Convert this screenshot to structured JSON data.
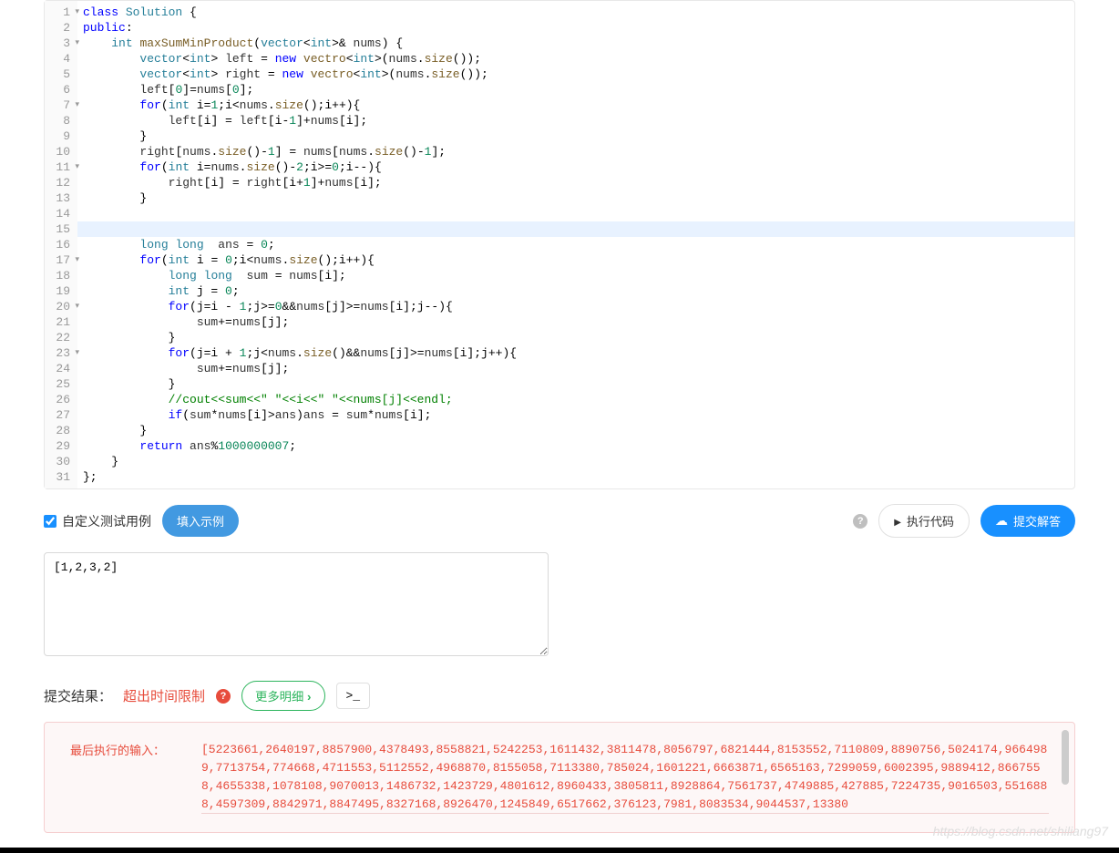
{
  "gutter": {
    "lines": [
      "1",
      "2",
      "3",
      "4",
      "5",
      "6",
      "7",
      "8",
      "9",
      "10",
      "11",
      "12",
      "13",
      "14",
      "15",
      "16",
      "17",
      "18",
      "19",
      "20",
      "21",
      "22",
      "23",
      "24",
      "25",
      "26",
      "27",
      "28",
      "29",
      "30",
      "31"
    ],
    "folds": [
      0,
      2,
      6,
      10,
      16,
      19,
      22
    ]
  },
  "code": [
    [
      [
        "kw",
        "class "
      ],
      [
        "cls",
        "Solution"
      ],
      [
        "op",
        " {"
      ]
    ],
    [
      [
        "kw",
        "public"
      ],
      [
        "op",
        ":"
      ]
    ],
    [
      [
        "op",
        "    "
      ],
      [
        "type",
        "int"
      ],
      [
        "op",
        " "
      ],
      [
        "func",
        "maxSumMinProduct"
      ],
      [
        "op",
        "("
      ],
      [
        "type",
        "vector"
      ],
      [
        "op",
        "<"
      ],
      [
        "type",
        "int"
      ],
      [
        "op",
        ">& "
      ],
      [
        "",
        "nums"
      ],
      [
        "op",
        ") {"
      ]
    ],
    [
      [
        "op",
        "        "
      ],
      [
        "type",
        "vector"
      ],
      [
        "op",
        "<"
      ],
      [
        "type",
        "int"
      ],
      [
        "op",
        "> "
      ],
      [
        "",
        "left"
      ],
      [
        "op",
        " = "
      ],
      [
        "kw",
        "new"
      ],
      [
        "op",
        " "
      ],
      [
        "func",
        "vectro"
      ],
      [
        "op",
        "<"
      ],
      [
        "type",
        "int"
      ],
      [
        "op",
        ">("
      ],
      [
        "",
        "nums"
      ],
      [
        "op",
        "."
      ],
      [
        "func",
        "size"
      ],
      [
        "op",
        "());"
      ]
    ],
    [
      [
        "op",
        "        "
      ],
      [
        "type",
        "vector"
      ],
      [
        "op",
        "<"
      ],
      [
        "type",
        "int"
      ],
      [
        "op",
        "> "
      ],
      [
        "",
        "right"
      ],
      [
        "op",
        " = "
      ],
      [
        "kw",
        "new"
      ],
      [
        "op",
        " "
      ],
      [
        "func",
        "vectro"
      ],
      [
        "op",
        "<"
      ],
      [
        "type",
        "int"
      ],
      [
        "op",
        ">("
      ],
      [
        "",
        "nums"
      ],
      [
        "op",
        "."
      ],
      [
        "func",
        "size"
      ],
      [
        "op",
        "());"
      ]
    ],
    [
      [
        "op",
        "        "
      ],
      [
        "",
        "left"
      ],
      [
        "op",
        "["
      ],
      [
        "num",
        "0"
      ],
      [
        "op",
        "]="
      ],
      [
        "",
        "nums"
      ],
      [
        "op",
        "["
      ],
      [
        "num",
        "0"
      ],
      [
        "op",
        "];"
      ]
    ],
    [
      [
        "op",
        "        "
      ],
      [
        "kw",
        "for"
      ],
      [
        "op",
        "("
      ],
      [
        "type",
        "int"
      ],
      [
        "op",
        " i="
      ],
      [
        "num",
        "1"
      ],
      [
        "op",
        ";i<"
      ],
      [
        "",
        "nums"
      ],
      [
        "op",
        "."
      ],
      [
        "func",
        "size"
      ],
      [
        "op",
        "();i"
      ],
      [
        "op",
        "++"
      ],
      [
        "op",
        "){"
      ]
    ],
    [
      [
        "op",
        "            "
      ],
      [
        "",
        "left"
      ],
      [
        "op",
        "[i] = "
      ],
      [
        "",
        "left"
      ],
      [
        "op",
        "[i"
      ],
      [
        "op",
        "-"
      ],
      [
        "num",
        "1"
      ],
      [
        "op",
        "]+"
      ],
      [
        "",
        "nums"
      ],
      [
        "op",
        "[i];"
      ]
    ],
    [
      [
        "op",
        "        }"
      ]
    ],
    [
      [
        "op",
        "        "
      ],
      [
        "",
        "right"
      ],
      [
        "op",
        "["
      ],
      [
        "",
        "nums"
      ],
      [
        "op",
        "."
      ],
      [
        "func",
        "size"
      ],
      [
        "op",
        "()"
      ],
      [
        "op",
        "-"
      ],
      [
        "num",
        "1"
      ],
      [
        "op",
        "] = "
      ],
      [
        "",
        "nums"
      ],
      [
        "op",
        "["
      ],
      [
        "",
        "nums"
      ],
      [
        "op",
        "."
      ],
      [
        "func",
        "size"
      ],
      [
        "op",
        "()"
      ],
      [
        "op",
        "-"
      ],
      [
        "num",
        "1"
      ],
      [
        "op",
        "];"
      ]
    ],
    [
      [
        "op",
        "        "
      ],
      [
        "kw",
        "for"
      ],
      [
        "op",
        "("
      ],
      [
        "type",
        "int"
      ],
      [
        "op",
        " i="
      ],
      [
        "",
        "nums"
      ],
      [
        "op",
        "."
      ],
      [
        "func",
        "size"
      ],
      [
        "op",
        "()"
      ],
      [
        "op",
        "-"
      ],
      [
        "num",
        "2"
      ],
      [
        "op",
        ";i>="
      ],
      [
        "num",
        "0"
      ],
      [
        "op",
        ";i"
      ],
      [
        "op",
        "--"
      ],
      [
        "op",
        "){"
      ]
    ],
    [
      [
        "op",
        "            "
      ],
      [
        "",
        "right"
      ],
      [
        "op",
        "[i] = "
      ],
      [
        "",
        "right"
      ],
      [
        "op",
        "[i"
      ],
      [
        "op",
        "+"
      ],
      [
        "num",
        "1"
      ],
      [
        "op",
        "]+"
      ],
      [
        "",
        "nums"
      ],
      [
        "op",
        "[i];"
      ]
    ],
    [
      [
        "op",
        "        }"
      ]
    ],
    [
      [
        "",
        ""
      ]
    ],
    [
      [
        "",
        ""
      ]
    ],
    [
      [
        "op",
        "        "
      ],
      [
        "type",
        "long"
      ],
      [
        "op",
        " "
      ],
      [
        "type",
        "long"
      ],
      [
        "op",
        "  "
      ],
      [
        "",
        "ans"
      ],
      [
        "op",
        " = "
      ],
      [
        "num",
        "0"
      ],
      [
        "op",
        ";"
      ]
    ],
    [
      [
        "op",
        "        "
      ],
      [
        "kw",
        "for"
      ],
      [
        "op",
        "("
      ],
      [
        "type",
        "int"
      ],
      [
        "op",
        " i = "
      ],
      [
        "num",
        "0"
      ],
      [
        "op",
        ";i<"
      ],
      [
        "",
        "nums"
      ],
      [
        "op",
        "."
      ],
      [
        "func",
        "size"
      ],
      [
        "op",
        "();i"
      ],
      [
        "op",
        "++"
      ],
      [
        "op",
        "){"
      ]
    ],
    [
      [
        "op",
        "            "
      ],
      [
        "type",
        "long"
      ],
      [
        "op",
        " "
      ],
      [
        "type",
        "long"
      ],
      [
        "op",
        "  "
      ],
      [
        "",
        "sum"
      ],
      [
        "op",
        " = "
      ],
      [
        "",
        "nums"
      ],
      [
        "op",
        "[i];"
      ]
    ],
    [
      [
        "op",
        "            "
      ],
      [
        "type",
        "int"
      ],
      [
        "op",
        " j = "
      ],
      [
        "num",
        "0"
      ],
      [
        "op",
        ";"
      ]
    ],
    [
      [
        "op",
        "            "
      ],
      [
        "kw",
        "for"
      ],
      [
        "op",
        "(j=i "
      ],
      [
        "op",
        "-"
      ],
      [
        "op",
        " "
      ],
      [
        "num",
        "1"
      ],
      [
        "op",
        ";j>="
      ],
      [
        "num",
        "0"
      ],
      [
        "op",
        "&&"
      ],
      [
        "",
        "nums"
      ],
      [
        "op",
        "[j]>="
      ],
      [
        "",
        "nums"
      ],
      [
        "op",
        "[i];j"
      ],
      [
        "op",
        "--"
      ],
      [
        "op",
        "){"
      ]
    ],
    [
      [
        "op",
        "                "
      ],
      [
        "",
        "sum"
      ],
      [
        "op",
        "+="
      ],
      [
        "",
        "nums"
      ],
      [
        "op",
        "[j];"
      ]
    ],
    [
      [
        "op",
        "            }"
      ]
    ],
    [
      [
        "op",
        "            "
      ],
      [
        "kw",
        "for"
      ],
      [
        "op",
        "(j=i "
      ],
      [
        "op",
        "+"
      ],
      [
        "op",
        " "
      ],
      [
        "num",
        "1"
      ],
      [
        "op",
        ";j<"
      ],
      [
        "",
        "nums"
      ],
      [
        "op",
        "."
      ],
      [
        "func",
        "size"
      ],
      [
        "op",
        "()&&"
      ],
      [
        "",
        "nums"
      ],
      [
        "op",
        "[j]>="
      ],
      [
        "",
        "nums"
      ],
      [
        "op",
        "[i];j"
      ],
      [
        "op",
        "++"
      ],
      [
        "op",
        "){"
      ]
    ],
    [
      [
        "op",
        "                "
      ],
      [
        "",
        "sum"
      ],
      [
        "op",
        "+="
      ],
      [
        "",
        "nums"
      ],
      [
        "op",
        "[j];"
      ]
    ],
    [
      [
        "op",
        "            }"
      ]
    ],
    [
      [
        "op",
        "            "
      ],
      [
        "comment",
        "//cout<<sum<<\" \"<<i<<\" \"<<nums[j]<<endl;"
      ]
    ],
    [
      [
        "op",
        "            "
      ],
      [
        "kw",
        "if"
      ],
      [
        "op",
        "("
      ],
      [
        "",
        "sum"
      ],
      [
        "op",
        "*"
      ],
      [
        "",
        "nums"
      ],
      [
        "op",
        "[i]>"
      ],
      [
        "",
        "ans"
      ],
      [
        "op",
        ")"
      ],
      [
        "",
        "ans"
      ],
      [
        "op",
        " = "
      ],
      [
        "",
        "sum"
      ],
      [
        "op",
        "*"
      ],
      [
        "",
        "nums"
      ],
      [
        "op",
        "[i];"
      ]
    ],
    [
      [
        "op",
        "        }"
      ]
    ],
    [
      [
        "op",
        "        "
      ],
      [
        "kw",
        "return"
      ],
      [
        "op",
        " "
      ],
      [
        "",
        "ans"
      ],
      [
        "op",
        "%"
      ],
      [
        "num",
        "1000000007"
      ],
      [
        "op",
        ";"
      ]
    ],
    [
      [
        "op",
        "    }"
      ]
    ],
    [
      [
        "op",
        "};"
      ]
    ]
  ],
  "highlight_line": 14,
  "actions": {
    "checkbox_label": "自定义测试用例",
    "fill_example": "填入示例",
    "run_code": "执行代码",
    "submit": "提交解答"
  },
  "testcase": {
    "value": "[1,2,3,2]"
  },
  "result": {
    "label": "提交结果：",
    "status": "超出时间限制",
    "more_detail": "更多明细",
    "terminal": ">_"
  },
  "result_box": {
    "label": "最后执行的输入：",
    "content": "[5223661,2640197,8857900,4378493,8558821,5242253,1611432,3811478,8056797,6821444,8153552,7110809,8890756,5024174,9664989,7713754,774668,4711553,5112552,4968870,8155058,7113380,785024,1601221,6663871,6565163,7299059,6002395,9889412,8667558,4655338,1078108,9070013,1486732,1423729,4801612,8960433,3805811,8928864,7561737,4749885,427885,7224735,9016503,5516888,4597309,8842971,8847495,8327168,8926470,1245849,6517662,376123,7981,8083534,9044537,13380"
  },
  "watermark": "https://blog.csdn.net/shiliang97"
}
